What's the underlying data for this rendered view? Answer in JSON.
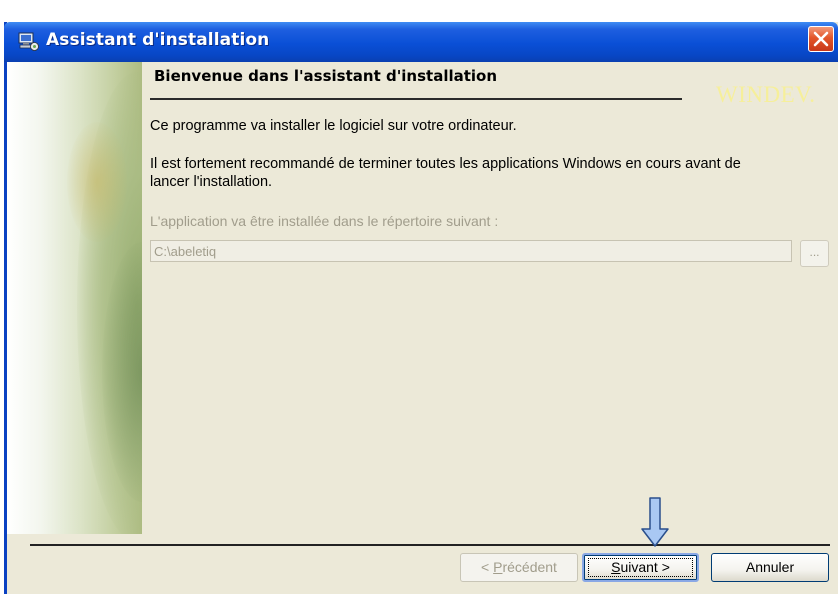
{
  "window": {
    "title": "Assistant d'installation",
    "close_icon": "close-icon",
    "app_icon": "computer-install-icon"
  },
  "main": {
    "heading": "Bienvenue dans l'assistant d'installation",
    "brand": "WINDEV.",
    "intro": "Ce programme va installer le logiciel sur votre ordinateur.",
    "recommendation_line1": "Il est fortement recommandé de terminer toutes les applications Windows en cours avant de",
    "recommendation_line2": "lancer l'installation.",
    "directory_label": "L'application va être installée dans le répertoire suivant :",
    "directory_value": "C:\\abeletiq",
    "browse_label": "..."
  },
  "buttons": {
    "previous_mnemonic": "P",
    "previous_rest": "récédent",
    "previous_prefix": "< ",
    "next_mnemonic": "S",
    "next_rest": "uivant >",
    "cancel": "Annuler"
  },
  "annotation": {
    "arrow_icon": "down-arrow-icon",
    "arrow_color": "#a9c8f3"
  },
  "colors": {
    "titlebar": "#0a4fd6",
    "window_bg": "#ece9d8",
    "brand": "#f6ef9a",
    "disabled_text": "#a19d8c"
  }
}
